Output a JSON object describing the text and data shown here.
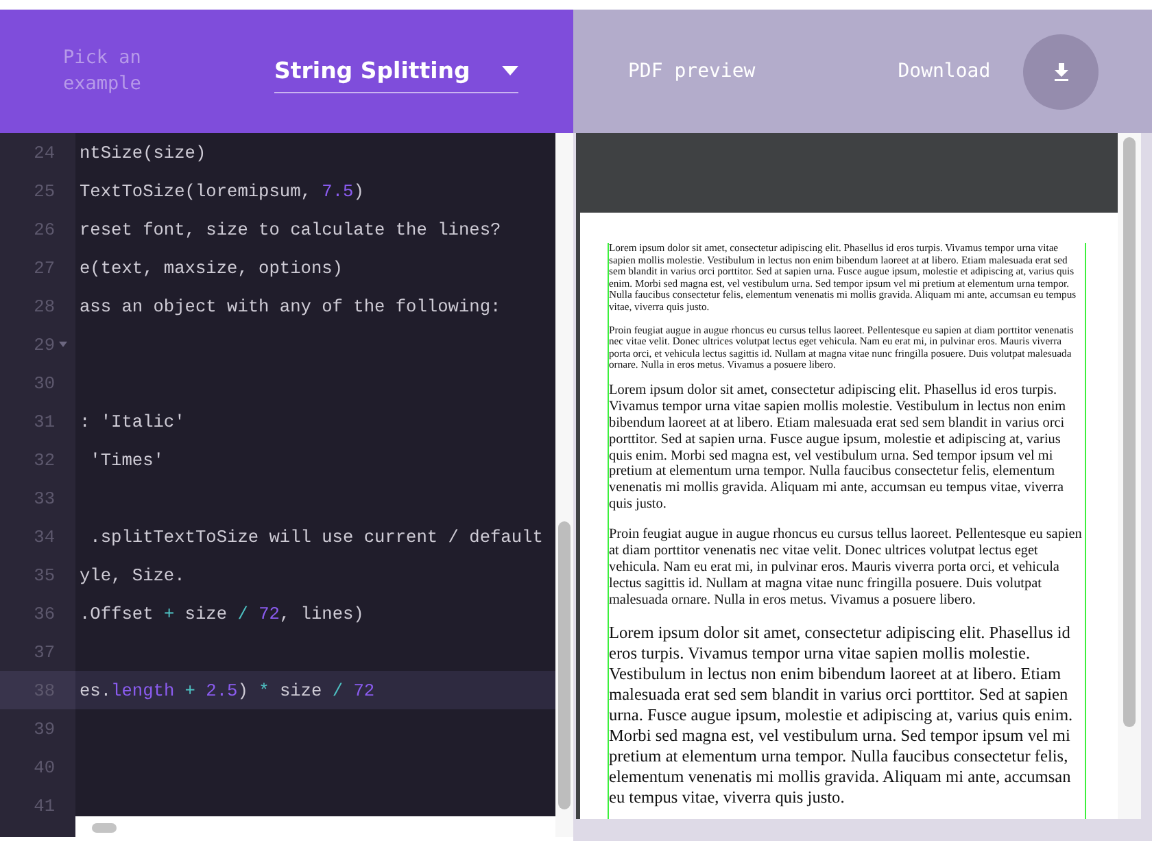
{
  "header": {
    "picker_label": "Pick an example",
    "example_select": {
      "value": "String Splitting"
    },
    "links": [
      {
        "label": "PDF preview"
      },
      {
        "label": "Download"
      }
    ]
  },
  "editor": {
    "lines": [
      {
        "number": "24",
        "active": false,
        "foldable": false,
        "tokens": [
          {
            "text": "ntSize(size)",
            "kind": "plain"
          }
        ]
      },
      {
        "number": "25",
        "active": false,
        "foldable": false,
        "tokens": [
          {
            "text": "TextToSize(loremipsum, ",
            "kind": "plain"
          },
          {
            "text": "7.5",
            "kind": "number"
          },
          {
            "text": ")",
            "kind": "plain"
          }
        ]
      },
      {
        "number": "26",
        "active": false,
        "foldable": false,
        "tokens": [
          {
            "text": "reset font, size to calculate the lines?",
            "kind": "plain"
          }
        ]
      },
      {
        "number": "27",
        "active": false,
        "foldable": false,
        "tokens": [
          {
            "text": "e(text, maxsize, options)",
            "kind": "plain"
          }
        ]
      },
      {
        "number": "28",
        "active": false,
        "foldable": false,
        "tokens": [
          {
            "text": "ass an object with any of the following:",
            "kind": "plain"
          }
        ]
      },
      {
        "number": "29",
        "active": false,
        "foldable": true
      },
      {
        "number": "30",
        "active": false,
        "foldable": false
      },
      {
        "number": "31",
        "active": false,
        "foldable": false,
        "tokens": [
          {
            "text": ": 'Italic'",
            "kind": "plain"
          }
        ]
      },
      {
        "number": "32",
        "active": false,
        "foldable": false,
        "tokens": [
          {
            "text": " 'Times'",
            "kind": "plain"
          }
        ]
      },
      {
        "number": "33",
        "active": false,
        "foldable": false
      },
      {
        "number": "34",
        "active": false,
        "foldable": false,
        "tokens": [
          {
            "text": " .splitTextToSize will use current / default",
            "kind": "plain"
          }
        ]
      },
      {
        "number": "35",
        "active": false,
        "foldable": false,
        "tokens": [
          {
            "text": "yle, Size.",
            "kind": "plain"
          }
        ]
      },
      {
        "number": "36",
        "active": false,
        "foldable": false,
        "tokens": [
          {
            "text": ".Offset ",
            "kind": "plain"
          },
          {
            "text": "+",
            "kind": "operator"
          },
          {
            "text": " size ",
            "kind": "plain"
          },
          {
            "text": "/ ",
            "kind": "operator"
          },
          {
            "text": "72",
            "kind": "number"
          },
          {
            "text": ", lines)",
            "kind": "plain"
          }
        ]
      },
      {
        "number": "37",
        "active": false,
        "foldable": false
      },
      {
        "number": "38",
        "active": true,
        "foldable": false,
        "tokens": [
          {
            "text": "es.",
            "kind": "plain"
          },
          {
            "text": "length",
            "kind": "number"
          },
          {
            "text": " + ",
            "kind": "operator"
          },
          {
            "text": "2.5",
            "kind": "number"
          },
          {
            "text": ") ",
            "kind": "plain"
          },
          {
            "text": "*",
            "kind": "operator"
          },
          {
            "text": " size ",
            "kind": "plain"
          },
          {
            "text": "/ ",
            "kind": "operator"
          },
          {
            "text": "72",
            "kind": "number"
          }
        ]
      },
      {
        "number": "39",
        "active": false,
        "foldable": false
      },
      {
        "number": "40",
        "active": false,
        "foldable": false
      },
      {
        "number": "41",
        "active": false,
        "foldable": false
      }
    ]
  },
  "pdf_preview": {
    "paragraphs": [
      {
        "kind": "small",
        "text": "Lorem ipsum dolor sit amet, consectetur adipiscing elit. Phasellus id eros turpis. Vivamus tempor urna vitae sapien mollis molestie. Vestibulum in lectus non enim bibendum laoreet at at libero. Etiam malesuada erat sed sem blandit in varius orci porttitor. Sed at sapien urna. Fusce augue ipsum, molestie et adipiscing at, varius quis enim. Morbi sed magna est, vel vestibulum urna. Sed tempor ipsum vel mi pretium at elementum urna tempor. Nulla faucibus consectetur felis, elementum venenatis mi mollis gravida. Aliquam mi ante, accumsan eu tempus vitae, viverra quis justo."
      },
      {
        "kind": "small",
        "text": "Proin feugiat augue in augue rhoncus eu cursus tellus laoreet. Pellentesque eu sapien at diam porttitor venenatis nec vitae velit. Donec ultrices volutpat lectus eget vehicula. Nam eu erat mi, in pulvinar eros. Mauris viverra porta orci, et vehicula lectus sagittis id. Nullam at magna vitae nunc fringilla posuere. Duis volutpat malesuada ornare. Nulla in eros metus. Vivamus a posuere libero."
      },
      {
        "kind": "medium",
        "text": "Lorem ipsum dolor sit amet, consectetur adipiscing elit. Phasellus id eros turpis. Vivamus tempor urna vitae sapien mollis molestie. Vestibulum in lectus non enim bibendum laoreet at at libero. Etiam malesuada erat sed sem blandit in varius orci porttitor. Sed at sapien urna. Fusce augue ipsum, molestie et adipiscing at, varius quis enim. Morbi sed magna est, vel vestibulum urna. Sed tempor ipsum vel mi pretium at elementum urna tempor. Nulla faucibus consectetur felis, elementum venenatis mi mollis gravida. Aliquam mi ante, accumsan eu tempus vitae, viverra quis justo."
      },
      {
        "kind": "medium",
        "text": "Proin feugiat augue in augue rhoncus eu cursus tellus laoreet. Pellentesque eu sapien at diam porttitor venenatis nec vitae velit. Donec ultrices volutpat lectus eget vehicula. Nam eu erat mi, in pulvinar eros. Mauris viverra porta orci, et vehicula lectus sagittis id. Nullam at magna vitae nunc fringilla posuere. Duis volutpat malesuada ornare. Nulla in eros metus. Vivamus a posuere libero."
      },
      {
        "kind": "large",
        "text": "Lorem ipsum dolor sit amet, consectetur adipiscing elit. Phasellus id eros turpis. Vivamus tempor urna vitae sapien mollis molestie. Vestibulum in lectus non enim bibendum laoreet at at libero. Etiam malesuada erat sed sem blandit in varius orci porttitor. Sed at sapien urna. Fusce augue ipsum, molestie et adipiscing at, varius quis enim. Morbi sed magna est, vel vestibulum urna. Sed tempor ipsum vel mi pretium at elementum urna tempor. Nulla faucibus consectetur felis, elementum venenatis mi mollis gravida. Aliquam mi ante, accumsan eu tempus vitae, viverra quis justo."
      }
    ]
  }
}
